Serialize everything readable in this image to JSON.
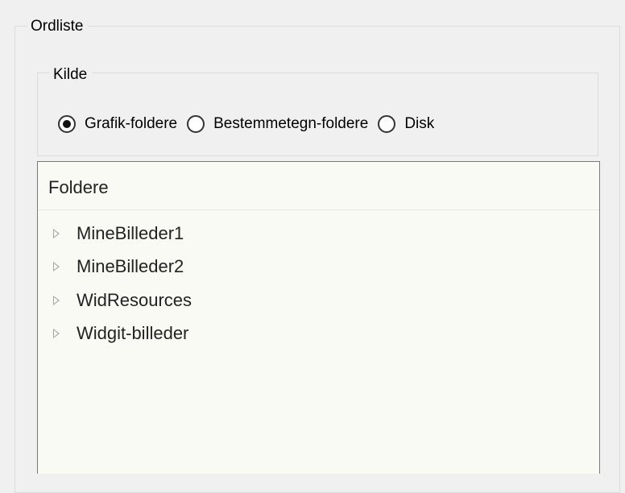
{
  "dictionary_group": {
    "title": "Ordliste"
  },
  "source_group": {
    "title": "Kilde",
    "options": [
      {
        "label": "Grafik-foldere",
        "selected": true
      },
      {
        "label": "Bestemmetegn-foldere",
        "selected": false
      },
      {
        "label": "Disk",
        "selected": false
      }
    ]
  },
  "folders_panel": {
    "header": "Foldere",
    "items": [
      {
        "label": "MineBilleder1",
        "icon": "expand-arrow-icon"
      },
      {
        "label": "MineBilleder2",
        "icon": "expand-arrow-icon"
      },
      {
        "label": "WidResources",
        "icon": "expand-arrow-icon"
      },
      {
        "label": "Widgit-billeder",
        "icon": "expand-arrow-icon"
      }
    ]
  }
}
